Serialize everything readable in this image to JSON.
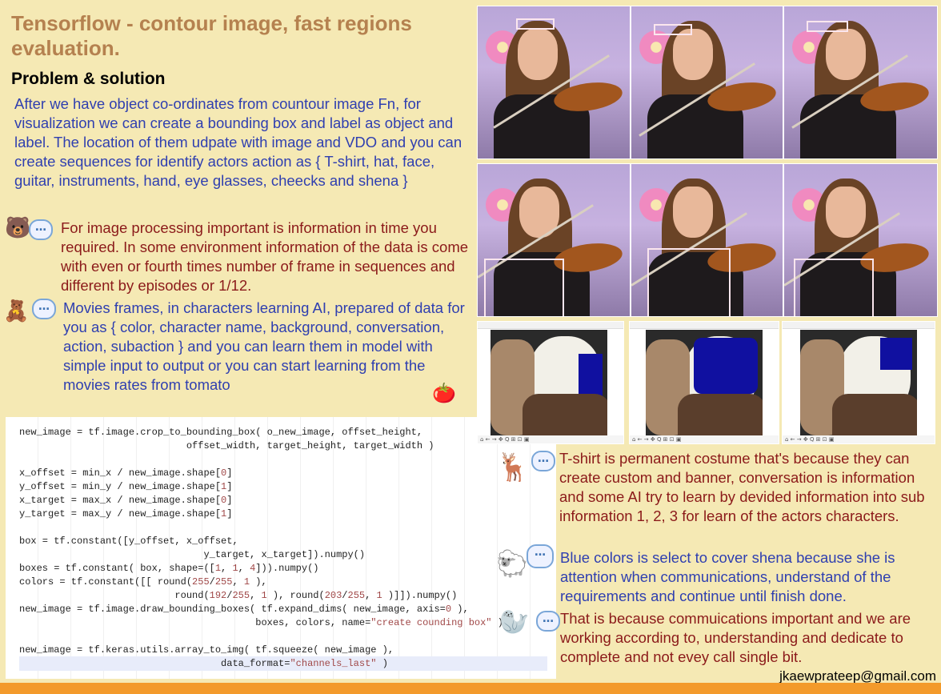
{
  "title": "Tensorflow - contour image, fast regions evaluation.",
  "subtitle": "Problem & solution",
  "para1": "After we have object co-ordinates from countour image Fn, for visualization we can create a bounding box and label as object and label. The location of them udpate with image and VDO and you can create sequences for identify actors action as { T-shirt, hat, face, guitar, instruments, hand, eye glasses, cheecks and shena }",
  "para2": "For image processing important is information in time you required. In some environment information of the data is come with even or fourth times number of frame in sequences and different by episodes or 1/12.",
  "para3": "Movies frames, in characters learning AI, prepared of data for you as { color, character name, background, conversation, action, subaction } and you can learn them in model with simple input to output or you can start learning from the movies rates from tomato",
  "para4": "T-shirt is permanent costume that's because they can create custom and banner, conversation is information and some AI try to learn by devided information into sub information 1, 2, 3 for learn of the actors characters.",
  "para5": "Blue colors is select to cover shena because she is attention when communications, understand of the requirements and continue until finish done.",
  "para6": "That is because commuications important and we are working according to, understanding and dedicate to complete and not evey call single bit.",
  "email": "jkaewprateep@gmail.com",
  "code_lines": [
    "new_image = tf.image.crop_to_bounding_box( o_new_image, offset_height,",
    "                             offset_width, target_height, target_width )",
    "",
    "x_offset = min_x / new_image.shape[0]",
    "y_offset = min_y / new_image.shape[1]",
    "x_target = max_x / new_image.shape[0]",
    "y_target = max_y / new_image.shape[1]",
    "",
    "box = tf.constant([y_offset, x_offset,",
    "                                y_target, x_target]).numpy()",
    "boxes = tf.constant( box, shape=([1, 1, 4])).numpy()",
    "colors = tf.constant([[ round(255/255, 1 ),",
    "                           round(192/255, 1 ), round(203/255, 1 )]]).numpy()",
    "new_image = tf.image.draw_bounding_boxes( tf.expand_dims( new_image, axis=0 ),",
    "                                         boxes, colors, name=\"create counding box\" )",
    "",
    "new_image = tf.keras.utils.array_to_img( tf.squeeze( new_image ),",
    "                                   data_format=\"channels_last\" )"
  ],
  "icons": {
    "emoji_bear_face": "🐻",
    "emoji_teddy": "🧸",
    "emoji_tomato": "🍅",
    "emoji_deer": "🦌",
    "emoji_sheep": "🐑",
    "emoji_seal": "🦭",
    "bubble": "…"
  },
  "screenshot_toolbar": "⌂ ← → ✥ Q ⊞ ⊡ ▣"
}
